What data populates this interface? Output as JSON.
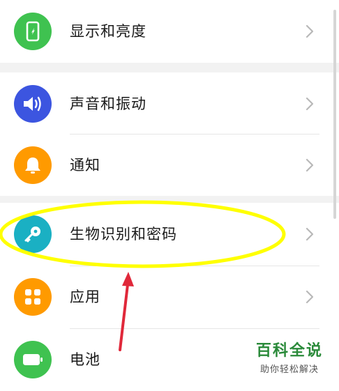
{
  "settings": {
    "items": [
      {
        "label": "显示和亮度",
        "icon": "phone-brightness-icon",
        "color": "#3fc250"
      },
      {
        "label": "声音和振动",
        "icon": "speaker-icon",
        "color": "#3c55e0"
      },
      {
        "label": "通知",
        "icon": "bell-icon",
        "color": "#ff9a00"
      },
      {
        "label": "生物识别和密码",
        "icon": "key-icon",
        "color": "#1ab0c3"
      },
      {
        "label": "应用",
        "icon": "apps-grid-icon",
        "color": "#ff9a00"
      },
      {
        "label": "电池",
        "icon": "battery-icon",
        "color": "#3fc250"
      }
    ]
  },
  "watermark": {
    "title": "百科全说",
    "subtitle": "助你轻松解决"
  },
  "colors": {
    "highlight": "#ffff00",
    "arrow": "#e0283a",
    "section_gap": "#f2f2f2"
  }
}
